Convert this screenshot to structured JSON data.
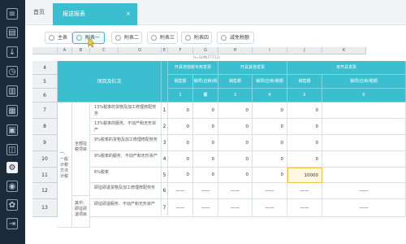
{
  "nav": {
    "home_label": "首页",
    "active_tab_label": "报送报表",
    "close_glyph": "×"
  },
  "sidebar": {
    "icons": [
      "book-icon",
      "document-icon",
      "download-icon",
      "clock-icon",
      "chart-icon",
      "grid-icon",
      "table-icon",
      "gift-icon",
      "settings-icon",
      "user-icon",
      "gear-icon",
      "logout-icon"
    ]
  },
  "sheet_tabs": [
    {
      "label": "主表"
    },
    {
      "label": "附表一"
    },
    {
      "label": "附表二"
    },
    {
      "label": "附表三"
    },
    {
      "label": "附表四"
    },
    {
      "label": "减免税额"
    }
  ],
  "columns": [
    "A",
    "B",
    "C",
    "D",
    "E",
    "F",
    "G",
    "H",
    "I",
    "J",
    "K"
  ],
  "header": {
    "project_label": "项目及栏次",
    "groups": [
      "开具增值税专用发票",
      "开具其他发票",
      "未开具发票"
    ],
    "sub_a": "销售额",
    "sub_b": "销项(应纳)税额",
    "col_numbers": [
      "1",
      "2",
      "3",
      "4",
      "5",
      "6"
    ]
  },
  "rows": [
    {
      "num": "7",
      "desc": "13%税率的货物及加工修理修配劳务",
      "line": "1",
      "vals": [
        "0",
        "0",
        "0",
        "0",
        "0",
        ""
      ]
    },
    {
      "num": "8",
      "desc": "13%税率的服务、不动产和无形资产",
      "line": "2",
      "vals": [
        "0",
        "0",
        "0",
        "0",
        "0",
        ""
      ]
    },
    {
      "num": "9",
      "desc": "9%税率的货物及加工修理修配劳务",
      "line": "3",
      "vals": [
        "0",
        "0",
        "0",
        "0",
        "0",
        ""
      ]
    },
    {
      "num": "10",
      "desc": "9%税率的服务、不动产和无形资产",
      "line": "4",
      "vals": [
        "0",
        "0",
        "0",
        "0",
        "0",
        ""
      ]
    },
    {
      "num": "11",
      "desc": "6%税率",
      "line": "5",
      "vals": [
        "0",
        "0",
        "0",
        "0",
        "10000",
        ""
      ]
    },
    {
      "num": "12",
      "desc": "即征即退货物及加工修理修配劳务",
      "line": "6",
      "vals": [
        "——",
        "——",
        "——",
        "——",
        "——",
        "——"
      ]
    },
    {
      "num": "13",
      "desc": "即征即退服务、不动产和无形资产",
      "line": "7",
      "vals": [
        "——",
        "——",
        "——",
        "——",
        "——",
        "——"
      ]
    }
  ],
  "side_labels": {
    "group_main": "一、一般计税方法计税",
    "group_all": "全部征税项目",
    "group_refund": "其中：即征即退项目"
  },
  "header_row_numbers": [
    "4",
    "5",
    "6"
  ],
  "formula_hint": "fx=SUM(F7:F13)"
}
